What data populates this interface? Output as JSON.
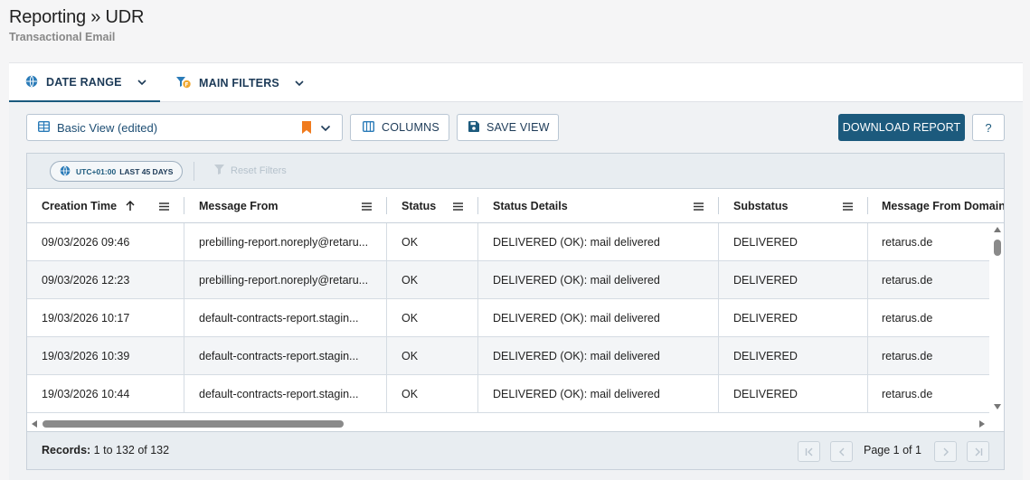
{
  "header": {
    "title": "Reporting » UDR",
    "subtitle": "Transactional Email"
  },
  "tabs": [
    {
      "label": "DATE RANGE",
      "icon": "globe-icon",
      "active": true
    },
    {
      "label": "MAIN FILTERS",
      "icon": "filter-icon",
      "active": false
    }
  ],
  "toolbar": {
    "view_label": "Basic View (edited)",
    "columns_label": "COLUMNS",
    "save_view_label": "SAVE VIEW",
    "download_label": "DOWNLOAD REPORT",
    "help_label": "?"
  },
  "grid": {
    "timezone": "UTC+01:00",
    "range": "LAST 45 DAYS",
    "reset_filters": "Reset Filters",
    "columns": [
      "Creation Time",
      "Message From",
      "Status",
      "Status Details",
      "Substatus",
      "Message From Domain"
    ],
    "rows": [
      [
        "09/03/2026 09:46",
        "prebilling-report.noreply@retaru...",
        "OK",
        "DELIVERED (OK): mail delivered",
        "DELIVERED",
        "retarus.de"
      ],
      [
        "09/03/2026 12:23",
        "prebilling-report.noreply@retaru...",
        "OK",
        "DELIVERED (OK): mail delivered",
        "DELIVERED",
        "retarus.de"
      ],
      [
        "19/03/2026 10:17",
        "default-contracts-report.stagin...",
        "OK",
        "DELIVERED (OK): mail delivered",
        "DELIVERED",
        "retarus.de"
      ],
      [
        "19/03/2026 10:39",
        "default-contracts-report.stagin...",
        "OK",
        "DELIVERED (OK): mail delivered",
        "DELIVERED",
        "retarus.de"
      ],
      [
        "19/03/2026 10:44",
        "default-contracts-report.stagin...",
        "OK",
        "DELIVERED (OK): mail delivered",
        "DELIVERED",
        "retarus.de"
      ]
    ],
    "footer": {
      "records_label": "Records:",
      "records_value": "1 to 132 of 132",
      "page_info": "Page 1 of 1"
    }
  },
  "colors": {
    "accent": "#1c5a7d",
    "bookmark": "#f07b1e",
    "filter_badge": "#f0a830"
  }
}
